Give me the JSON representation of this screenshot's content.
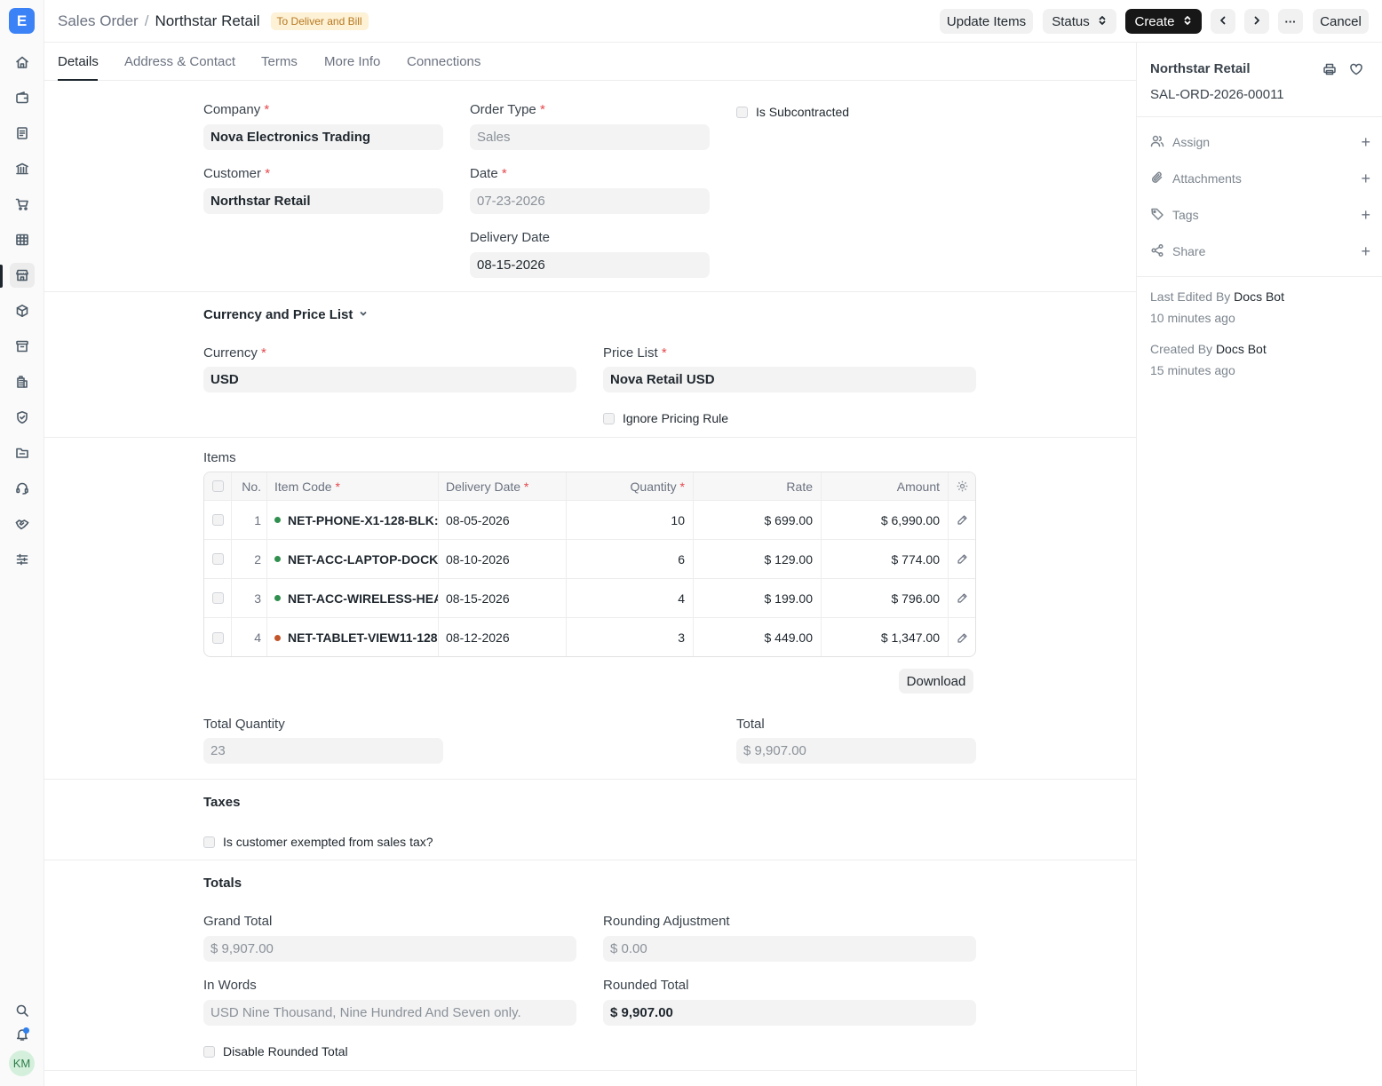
{
  "header": {
    "breadcrumb_parent": "Sales Order",
    "breadcrumb_sep": "/",
    "title": "Northstar Retail",
    "status": "To Deliver and Bill",
    "update_items_label": "Update Items",
    "status_label": "Status",
    "create_label": "Create",
    "more_label": "···",
    "cancel_label": "Cancel"
  },
  "rail": {
    "logo": "E",
    "avatar_initials": "KM",
    "icons": [
      "home-icon",
      "wallet-icon",
      "file-text-icon",
      "bank-icon",
      "cart-icon",
      "table-icon",
      "store-icon",
      "box-icon",
      "archive-icon",
      "building-icon",
      "shield-icon",
      "folder-icon",
      "headset-icon",
      "handshake-icon",
      "sliders-icon"
    ],
    "bottom_icons": [
      "search-icon",
      "bell-icon"
    ]
  },
  "tabs": [
    {
      "label": "Details",
      "active": true
    },
    {
      "label": "Address & Contact",
      "active": false
    },
    {
      "label": "Terms",
      "active": false
    },
    {
      "label": "More Info",
      "active": false
    },
    {
      "label": "Connections",
      "active": false
    }
  ],
  "form": {
    "company_label": "Company",
    "company": "Nova Electronics Trading",
    "order_type_label": "Order Type",
    "order_type": "Sales",
    "is_subcontracted_label": "Is Subcontracted",
    "customer_label": "Customer",
    "customer": "Northstar Retail",
    "date_label": "Date",
    "date": "07-23-2026",
    "delivery_date_label": "Delivery Date",
    "delivery_date": "08-15-2026",
    "required_mark": "*"
  },
  "currency_section": {
    "title": "Currency and Price List",
    "currency_label": "Currency",
    "currency": "USD",
    "price_list_label": "Price List",
    "price_list": "Nova Retail USD",
    "ignore_pricing_rule_label": "Ignore Pricing Rule"
  },
  "items": {
    "label": "Items",
    "columns": {
      "no": "No.",
      "item_code": "Item Code",
      "delivery_date": "Delivery Date",
      "quantity": "Quantity",
      "rate": "Rate",
      "amount": "Amount"
    },
    "rows": [
      {
        "no": "1",
        "item_code": "NET-PHONE-X1-128-BLK:",
        "status_color": "#2f8f4e",
        "delivery_date": "08-05-2026",
        "quantity": "10",
        "rate": "$ 699.00",
        "amount": "$ 6,990.00"
      },
      {
        "no": "2",
        "item_code": "NET-ACC-LAPTOP-DOCK",
        "status_color": "#2f8f4e",
        "delivery_date": "08-10-2026",
        "quantity": "6",
        "rate": "$ 129.00",
        "amount": "$ 774.00"
      },
      {
        "no": "3",
        "item_code": "NET-ACC-WIRELESS-HEA",
        "status_color": "#2f8f4e",
        "delivery_date": "08-15-2026",
        "quantity": "4",
        "rate": "$ 199.00",
        "amount": "$ 796.00"
      },
      {
        "no": "4",
        "item_code": "NET-TABLET-VIEW11-128-",
        "status_color": "#c2562a",
        "delivery_date": "08-12-2026",
        "quantity": "3",
        "rate": "$ 449.00",
        "amount": "$ 1,347.00"
      }
    ],
    "download_label": "Download",
    "total_quantity_label": "Total Quantity",
    "total_quantity": "23",
    "total_label": "Total",
    "total": "$ 9,907.00"
  },
  "taxes": {
    "title": "Taxes",
    "exempt_label": "Is customer exempted from sales tax?"
  },
  "totals": {
    "title": "Totals",
    "grand_total_label": "Grand Total",
    "grand_total": "$ 9,907.00",
    "rounding_adjustment_label": "Rounding Adjustment",
    "rounding_adjustment": "$ 0.00",
    "in_words_label": "In Words",
    "in_words": "USD Nine Thousand, Nine Hundred And Seven only.",
    "rounded_total_label": "Rounded Total",
    "rounded_total": "$ 9,907.00",
    "disable_rounded_total_label": "Disable Rounded Total"
  },
  "sidebar": {
    "title": "Northstar Retail",
    "doc_id": "SAL-ORD-2026-00011",
    "assign_label": "Assign",
    "attachments_label": "Attachments",
    "tags_label": "Tags",
    "share_label": "Share",
    "last_edited_prefix": "Last Edited By",
    "last_edited_by": "Docs Bot",
    "last_edited_time": "10 minutes ago",
    "created_prefix": "Created By",
    "created_by": "Docs Bot",
    "created_time": "15 minutes ago"
  },
  "colors": {
    "status_pill_bg": "#fdf1d6",
    "status_pill_text": "#b7791f",
    "brand": "#3b82f6",
    "required": "#e5484d"
  }
}
